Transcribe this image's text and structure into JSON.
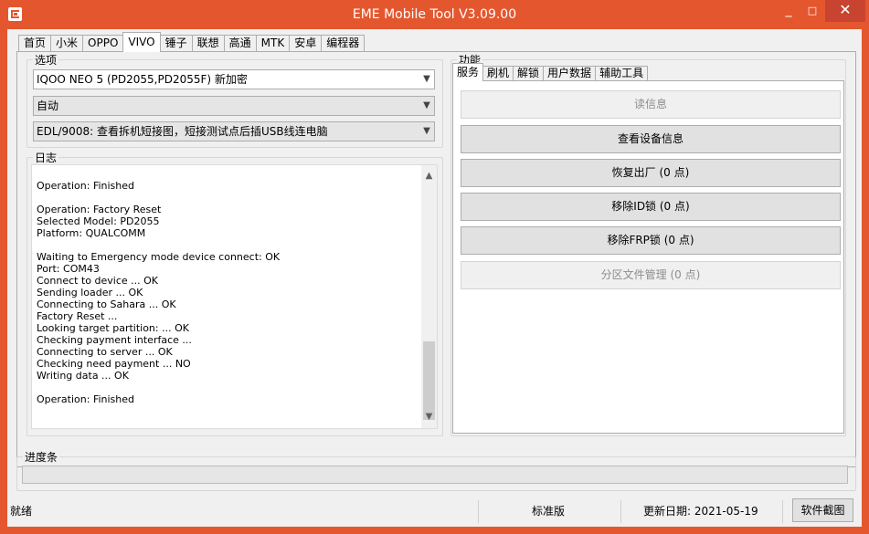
{
  "window": {
    "title": "EME Mobile Tool V3.09.00",
    "min_glyph": "_",
    "max_glyph": "□",
    "close_glyph": "✕",
    "accent": "#e4572e"
  },
  "top_tabs": [
    "首页",
    "小米",
    "OPPO",
    "VIVO",
    "锤子",
    "联想",
    "高通",
    "MTK",
    "安卓",
    "编程器"
  ],
  "top_tab_active": "VIVO",
  "options": {
    "label": "选项",
    "model": "IQOO NEO 5 (PD2055,PD2055F) 新加密",
    "mode": "自动",
    "method": "EDL/9008: 查看拆机短接图，短接测试点后插USB线连电脑"
  },
  "log": {
    "label": "日志",
    "lines": [
      "Operation: Finished",
      "",
      "Operation: Factory Reset",
      "Selected Model: PD2055",
      "Platform: QUALCOMM",
      "",
      "Waiting to Emergency mode device connect: OK",
      "Port: COM43",
      "Connect to device ... OK",
      "Sending loader ... OK",
      "Connecting to Sahara ... OK",
      "Factory Reset ...",
      "Looking target partition: ... OK",
      "Checking payment interface ...",
      "Connecting to server ... OK",
      "Checking need payment ... NO",
      "Writing data ... OK",
      "",
      "Operation: Finished"
    ]
  },
  "functions": {
    "label": "功能",
    "tabs": [
      "服务",
      "刷机",
      "解锁",
      "用户数据",
      "辅助工具"
    ],
    "active_tab": "服务",
    "buttons": [
      {
        "label": "读信息",
        "enabled": false
      },
      {
        "label": "查看设备信息",
        "enabled": true
      },
      {
        "label": "恢复出厂 (0 点)",
        "enabled": true
      },
      {
        "label": "移除ID锁 (0 点)",
        "enabled": true
      },
      {
        "label": "移除FRP锁 (0 点)",
        "enabled": true
      },
      {
        "label": "分区文件管理 (0 点)",
        "enabled": false
      }
    ]
  },
  "progress": {
    "label": "进度条",
    "value": 0
  },
  "status": {
    "state": "就绪",
    "edition": "标准版",
    "update_date": "更新日期:  2021-05-19",
    "screenshot_button": "软件截图"
  }
}
